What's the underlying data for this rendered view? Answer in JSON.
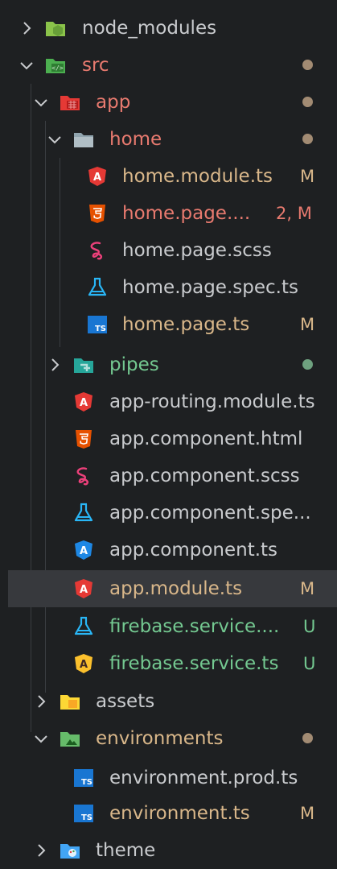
{
  "colors": {
    "background": "#1e2022",
    "selected": "#37393d",
    "modified": "#d9b78a",
    "untracked": "#74c991",
    "error": "#e87a6f",
    "default_text": "#c9cbce",
    "dot_modified": "#a28b73",
    "dot_untracked": "#6ea17f"
  },
  "items": [
    {
      "label": "node_modules",
      "icon": "folder-node-icon",
      "badge": "",
      "status": "default",
      "expanded": false,
      "is_folder": true
    },
    {
      "label": "src",
      "icon": "folder-src-icon",
      "badge": "",
      "status": "error",
      "expanded": true,
      "is_folder": true,
      "dot": "modified"
    },
    {
      "label": "app",
      "icon": "folder-app-icon",
      "badge": "",
      "status": "error",
      "expanded": true,
      "is_folder": true,
      "dot": "modified"
    },
    {
      "label": "home",
      "icon": "folder-home-icon",
      "badge": "",
      "status": "error",
      "expanded": true,
      "is_folder": true,
      "dot": "modified"
    },
    {
      "label": "home.module.ts",
      "icon": "angular-icon",
      "badge": "M",
      "status": "modified"
    },
    {
      "label": "home.page....",
      "icon": "html5-icon",
      "badge": "2, M",
      "status": "error"
    },
    {
      "label": "home.page.scss",
      "icon": "sass-icon",
      "badge": "",
      "status": "default"
    },
    {
      "label": "home.page.spec.ts",
      "icon": "test-flask-icon",
      "badge": "",
      "status": "default"
    },
    {
      "label": "home.page.ts",
      "icon": "typescript-icon",
      "badge": "M",
      "status": "modified"
    },
    {
      "label": "pipes",
      "icon": "folder-pipes-icon",
      "badge": "",
      "status": "untracked",
      "expanded": false,
      "is_folder": true,
      "dot": "untracked"
    },
    {
      "label": "app-routing.module.ts",
      "icon": "angular-icon",
      "badge": "",
      "status": "default"
    },
    {
      "label": "app.component.html",
      "icon": "html5-icon",
      "badge": "",
      "status": "default"
    },
    {
      "label": "app.component.scss",
      "icon": "sass-icon",
      "badge": "",
      "status": "default"
    },
    {
      "label": "app.component.spe...",
      "icon": "test-flask-icon",
      "badge": "",
      "status": "default"
    },
    {
      "label": "app.component.ts",
      "icon": "angular-component-icon",
      "badge": "",
      "status": "default"
    },
    {
      "label": "app.module.ts",
      "icon": "angular-icon",
      "badge": "M",
      "status": "modified",
      "selected": true
    },
    {
      "label": "firebase.service....",
      "icon": "test-flask-icon",
      "badge": "U",
      "status": "untracked"
    },
    {
      "label": "firebase.service.ts",
      "icon": "angular-service-icon",
      "badge": "U",
      "status": "untracked"
    },
    {
      "label": "assets",
      "icon": "folder-assets-icon",
      "badge": "",
      "status": "default",
      "expanded": false,
      "is_folder": true
    },
    {
      "label": "environments",
      "icon": "folder-environments-icon",
      "badge": "",
      "status": "modified",
      "expanded": true,
      "is_folder": true,
      "dot": "modified"
    },
    {
      "label": "environment.prod.ts",
      "icon": "typescript-icon",
      "badge": "",
      "status": "default"
    },
    {
      "label": "environment.ts",
      "icon": "typescript-icon",
      "badge": "M",
      "status": "modified"
    },
    {
      "label": "theme",
      "icon": "folder-theme-icon",
      "badge": "",
      "status": "default",
      "expanded": false,
      "is_folder": true
    }
  ]
}
